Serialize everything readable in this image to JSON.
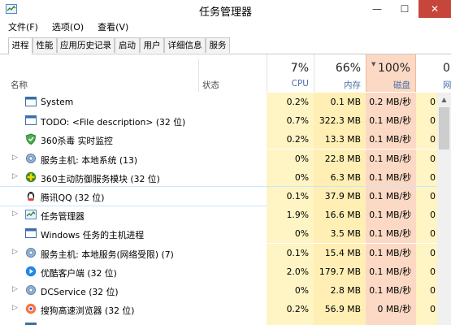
{
  "window": {
    "title": "任务管理器",
    "min": "—",
    "max": "☐",
    "close": "✕"
  },
  "menu": [
    "文件(F)",
    "选项(O)",
    "查看(V)"
  ],
  "tabs": [
    "进程",
    "性能",
    "应用历史记录",
    "启动",
    "用户",
    "详细信息",
    "服务"
  ],
  "columns": {
    "name": "名称",
    "status": "状态",
    "cpu": {
      "pct": "7%",
      "label": "CPU"
    },
    "mem": {
      "pct": "66%",
      "label": "内存"
    },
    "disk": {
      "pct": "100%",
      "label": "磁盘"
    },
    "net": {
      "pct": "0",
      "label": "网"
    }
  },
  "processes": [
    {
      "name": "System",
      "expandable": false,
      "icon": "window-icon",
      "cpu": "0.2%",
      "mem": "0.1 MB",
      "disk": "0.2 MB/秒",
      "net": "0"
    },
    {
      "name": "TODO: <File description> (32 位)",
      "expandable": false,
      "icon": "window-icon",
      "cpu": "0.7%",
      "mem": "322.3 MB",
      "disk": "0.1 MB/秒",
      "net": "0"
    },
    {
      "name": "360杀毒 实时监控",
      "expandable": false,
      "icon": "shield-icon",
      "cpu": "0.2%",
      "mem": "13.3 MB",
      "disk": "0.1 MB/秒",
      "net": "0"
    },
    {
      "name": "服务主机: 本地系统 (13)",
      "expandable": true,
      "icon": "gear-icon",
      "cpu": "0%",
      "mem": "22.8 MB",
      "disk": "0.1 MB/秒",
      "net": "0"
    },
    {
      "name": "360主动防御服务模块 (32 位)",
      "expandable": true,
      "icon": "shield-plus-icon",
      "cpu": "0%",
      "mem": "6.3 MB",
      "disk": "0.1 MB/秒",
      "net": "0"
    },
    {
      "name": "腾讯QQ (32 位)",
      "expandable": false,
      "icon": "penguin-icon",
      "cpu": "0.1%",
      "mem": "37.9 MB",
      "disk": "0.1 MB/秒",
      "net": "0",
      "selected": true
    },
    {
      "name": "任务管理器",
      "expandable": true,
      "icon": "taskmgr-icon",
      "cpu": "1.9%",
      "mem": "16.6 MB",
      "disk": "0.1 MB/秒",
      "net": "0"
    },
    {
      "name": "Windows 任务的主机进程",
      "expandable": false,
      "icon": "window-icon",
      "cpu": "0%",
      "mem": "3.5 MB",
      "disk": "0.1 MB/秒",
      "net": "0"
    },
    {
      "name": "服务主机: 本地服务(网络受限) (7)",
      "expandable": true,
      "icon": "gear-icon",
      "cpu": "0.1%",
      "mem": "15.4 MB",
      "disk": "0.1 MB/秒",
      "net": "0"
    },
    {
      "name": "优酷客户端 (32 位)",
      "expandable": false,
      "icon": "youku-icon",
      "cpu": "2.0%",
      "mem": "179.7 MB",
      "disk": "0.1 MB/秒",
      "net": "0"
    },
    {
      "name": "DCService (32 位)",
      "expandable": true,
      "icon": "gear-icon",
      "cpu": "0%",
      "mem": "2.8 MB",
      "disk": "0.1 MB/秒",
      "net": "0"
    },
    {
      "name": "搜狗高速浏览器 (32 位)",
      "expandable": true,
      "icon": "browser-icon",
      "cpu": "0.2%",
      "mem": "56.9 MB",
      "disk": "0 MB/秒",
      "net": "0"
    },
    {
      "name": "",
      "expandable": false,
      "icon": "window-icon",
      "cpu": "",
      "mem": "",
      "disk": "",
      "net": ""
    }
  ],
  "colors": {
    "disk_header": "#fbd9c4",
    "cpu_bg": "#fff4c4",
    "mem_bg": "#ffefb4",
    "close_btn": "#c7463b"
  }
}
